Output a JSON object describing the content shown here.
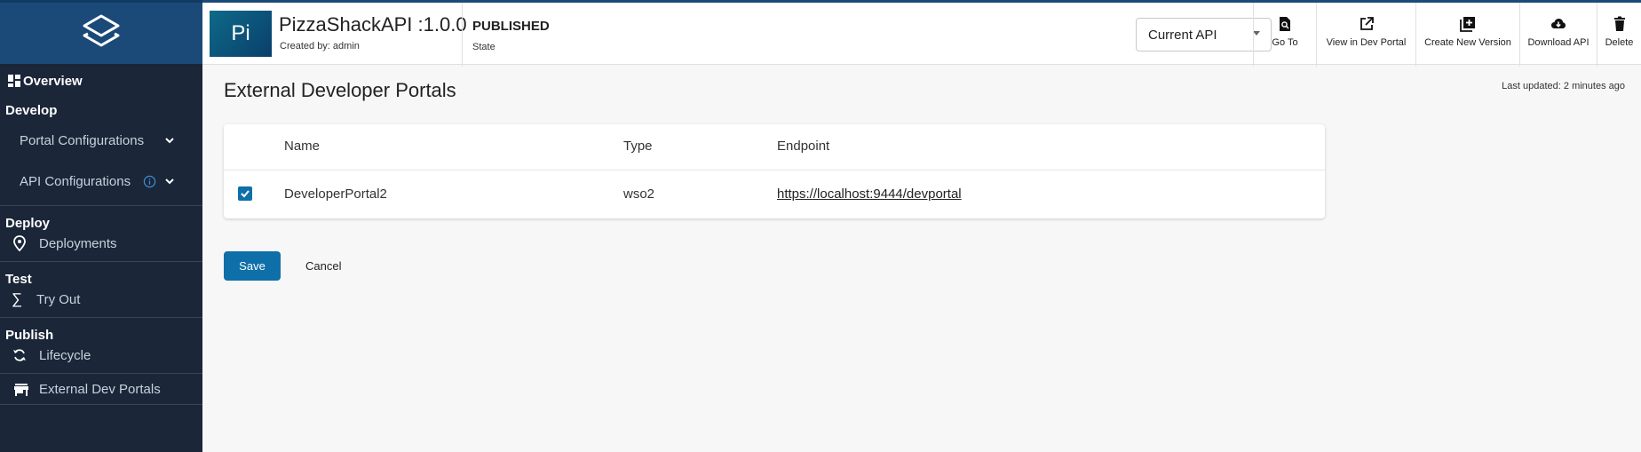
{
  "sidebar": {
    "logo_icon": "stacked-layers-icon",
    "overview": "Overview",
    "sections": [
      {
        "title": "Develop",
        "items": [
          "Portal Configurations",
          "API Configurations"
        ]
      },
      {
        "title": "Deploy",
        "items": [
          "Deployments"
        ]
      },
      {
        "title": "Test",
        "items": [
          "Try Out"
        ]
      },
      {
        "title": "Publish",
        "items": [
          "Lifecycle"
        ]
      }
    ],
    "external_dev_portals": "External Dev Portals"
  },
  "header": {
    "thumb_text": "Pi",
    "api_name": "PizzaShackAPI :1.0.0",
    "created_by": "Created by: admin",
    "state_value": "PUBLISHED",
    "state_label": "State",
    "current_api": "Current API",
    "actions": [
      "Go To",
      "View in Dev Portal",
      "Create New Version",
      "Download API",
      "Delete"
    ]
  },
  "main": {
    "title": "External Developer Portals",
    "last_updated": "Last updated: 2 minutes ago",
    "table": {
      "columns": [
        "Name",
        "Type",
        "Endpoint"
      ],
      "rows": [
        {
          "checked": true,
          "name": "DeveloperPortal2",
          "type": "wso2",
          "endpoint": "https://localhost:9444/devportal"
        }
      ]
    },
    "save": "Save",
    "cancel": "Cancel"
  },
  "colors": {
    "sidebar_bg": "#1b2638",
    "logo_bg": "#1b4a78",
    "primary": "#0f6fa8"
  }
}
